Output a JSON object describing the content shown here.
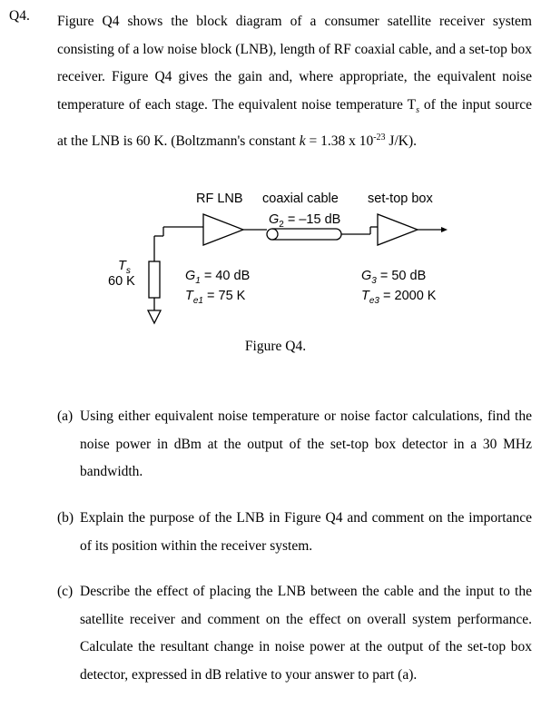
{
  "question": {
    "number": "Q4.",
    "intro": "Figure Q4 shows the block diagram of a consumer satellite receiver system consisting of a low noise block (LNB), length of RF coaxial cable, and a set-top box receiver. Figure Q4 gives the gain and, where appropriate, the equivalent noise temperature of each stage. The equivalent noise temperature T",
    "intro_sub": "s",
    "intro_cont": " of the input source at the LNB is 60 K. (Boltzmann's constant ",
    "k_symbol": "k",
    "k_value": " = 1.38 x 10",
    "k_exp": "-23",
    "k_unit": " J/K)."
  },
  "diagram": {
    "headers": {
      "lnb": "RF LNB",
      "cable": "coaxial cable",
      "stb": "set-top box"
    },
    "source": {
      "temp_symbol": "T",
      "temp_sub": "s",
      "temp_value": "60 K"
    },
    "cable_gain": {
      "symbol": "G",
      "sub": "2",
      "value": " = –15 dB"
    },
    "lnb": {
      "gain": {
        "symbol": "G",
        "sub": "1",
        "value": " = 40 dB"
      },
      "temp": {
        "symbol": "T",
        "sub": "e1",
        "value": " = 75 K"
      }
    },
    "stb": {
      "gain": {
        "symbol": "G",
        "sub": "3",
        "value": " = 50 dB"
      },
      "temp": {
        "symbol": "T",
        "sub": "e3",
        "value": " = 2000 K"
      }
    },
    "caption": "Figure Q4."
  },
  "parts": [
    {
      "label": "(a)",
      "text": "Using either equivalent noise temperature or noise factor calculations, find the noise power in dBm at the output of the set-top box detector in a 30 MHz bandwidth."
    },
    {
      "label": "(b)",
      "text": "Explain the purpose of the LNB in Figure Q4 and comment on the importance of its position within the receiver system."
    },
    {
      "label": "(c)",
      "text": "Describe the effect of placing the LNB between the cable and the input to the satellite receiver and comment on the effect on overall system performance. Calculate the resultant change in noise power at the output of the set-top box detector, expressed in dB relative to your answer to part (a)."
    }
  ]
}
